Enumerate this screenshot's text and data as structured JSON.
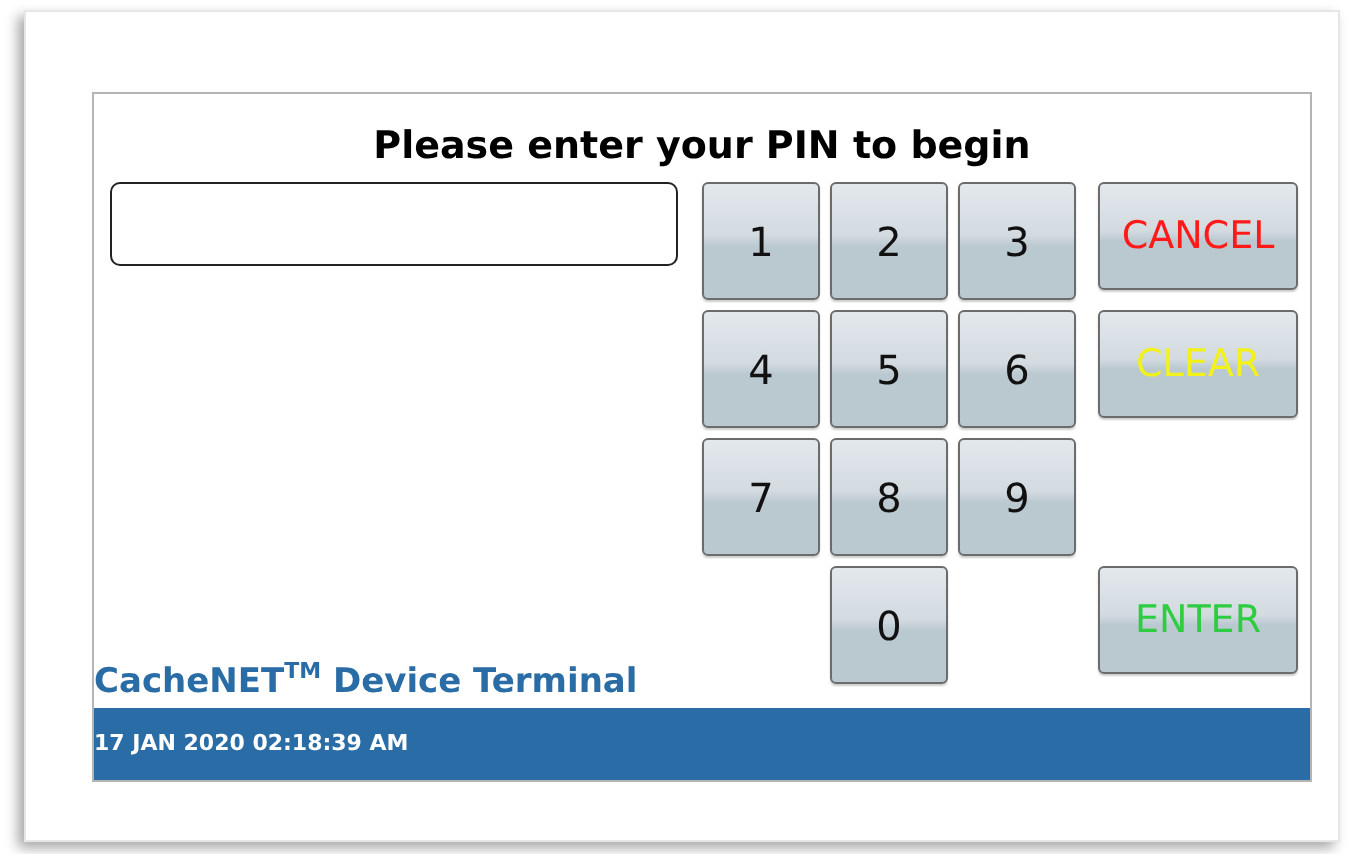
{
  "title": "Please enter your PIN to begin",
  "keypad": [
    {
      "label": "1"
    },
    {
      "label": "2"
    },
    {
      "label": "3"
    },
    {
      "label": "4"
    },
    {
      "label": "5"
    },
    {
      "label": "6"
    },
    {
      "label": "7"
    },
    {
      "label": "8"
    },
    {
      "label": "9"
    },
    {
      "label": "0"
    }
  ],
  "actions": [
    {
      "label": "CANCEL",
      "color": "#ff1a1a"
    },
    {
      "label": "CLEAR",
      "color": "#f2f21a"
    },
    {
      "label": "ENTER",
      "color": "#2ecc40"
    }
  ],
  "brand": "CacheNET$^{TM}$ Device Terminal",
  "status_bar": {
    "datetime": "17 JAN 2020 02:18:39 AM"
  }
}
